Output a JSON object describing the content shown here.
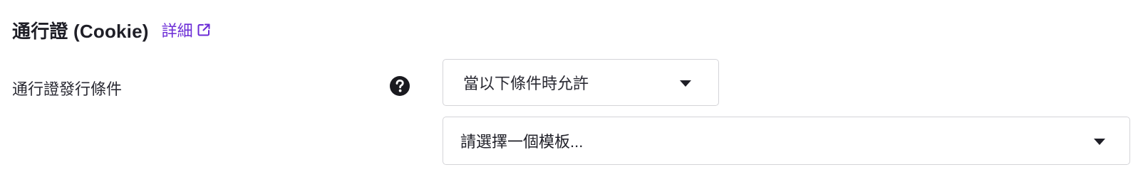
{
  "section": {
    "title": "通行證 (Cookie)",
    "details_link": "詳細",
    "details_icon": "external-link-icon",
    "link_color": "#6b2bd6"
  },
  "field": {
    "label": "通行證發行條件",
    "help_icon": "question-circle-icon",
    "condition_select": {
      "selected": "當以下條件時允許",
      "icon": "caret-down-icon"
    },
    "template_select": {
      "placeholder": "請選擇一個模板...",
      "icon": "caret-down-icon"
    }
  }
}
